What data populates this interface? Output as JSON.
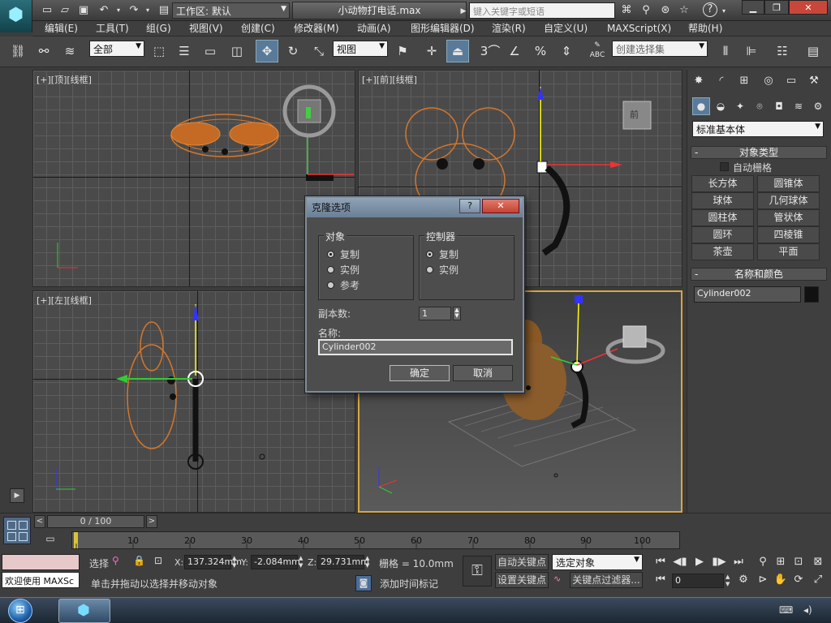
{
  "titlebar": {
    "workspace_label": "工作区: 默认",
    "document_title": "小动物打电话.max",
    "search_placeholder": "键入关键字或短语"
  },
  "menu": [
    "编辑(E)",
    "工具(T)",
    "组(G)",
    "视图(V)",
    "创建(C)",
    "修改器(M)",
    "动画(A)",
    "图形编辑器(D)",
    "渲染(R)",
    "自定义(U)",
    "MAXScript(X)",
    "帮助(H)"
  ],
  "toolbar": {
    "selection_filter": "全部",
    "reference_coord": "视图",
    "named_selection": "创建选择集",
    "snap_3": "3",
    "snap_pct": "%",
    "abc_label": "ABC"
  },
  "viewports": {
    "top": "[+][顶][线框]",
    "front": "[+][前][线框]",
    "left": "[+][左][线框]",
    "front_cube_label": "前"
  },
  "command_panel": {
    "category_dropdown": "标准基本体",
    "rollout_object_type": "对象类型",
    "autogrid_label": "自动栅格",
    "buttons": [
      "长方体",
      "圆锥体",
      "球体",
      "几何球体",
      "圆柱体",
      "管状体",
      "圆环",
      "四棱锥",
      "茶壶",
      "平面"
    ],
    "rollout_name_color": "名称和颜色",
    "name_value": "Cylinder002",
    "object_color": "#111111"
  },
  "dialog": {
    "title": "克隆选项",
    "help_symbol": "?",
    "close_symbol": "✕",
    "object_group": "对象",
    "object_options": [
      "复制",
      "实例",
      "参考"
    ],
    "object_selected": 0,
    "controller_group": "控制器",
    "controller_options": [
      "复制",
      "实例"
    ],
    "controller_selected": 0,
    "copies_label": "副本数:",
    "copies_value": "1",
    "name_label": "名称:",
    "name_value": "Cylinder002",
    "ok_label": "确定",
    "cancel_label": "取消"
  },
  "timeline": {
    "frame_readout": "0 / 100",
    "ticks": [
      "10",
      "20",
      "30",
      "40",
      "50",
      "60",
      "70",
      "80",
      "90",
      "100"
    ]
  },
  "status": {
    "welcome": "欢迎使用 MAXSc",
    "select_label": "选择",
    "x_label": "X:",
    "x_value": "137.324mm",
    "y_label": "Y:",
    "y_value": "-2.084mm",
    "z_label": "Z:",
    "z_value": "29.731mm",
    "grid": "栅格 = 10.0mm",
    "prompt": "单击并拖动以选择并移动对象",
    "add_time_tag": "添加时间标记",
    "auto_key": "自动关键点",
    "set_key": "设置关键点",
    "key_mode_select": "选定对象",
    "key_filters": "关键点过滤器...",
    "frame_field": "0"
  },
  "colors": {
    "wire_orange": "#d4762b",
    "active_border": "#d9a741",
    "dialog_title": "#7b8fa5"
  }
}
